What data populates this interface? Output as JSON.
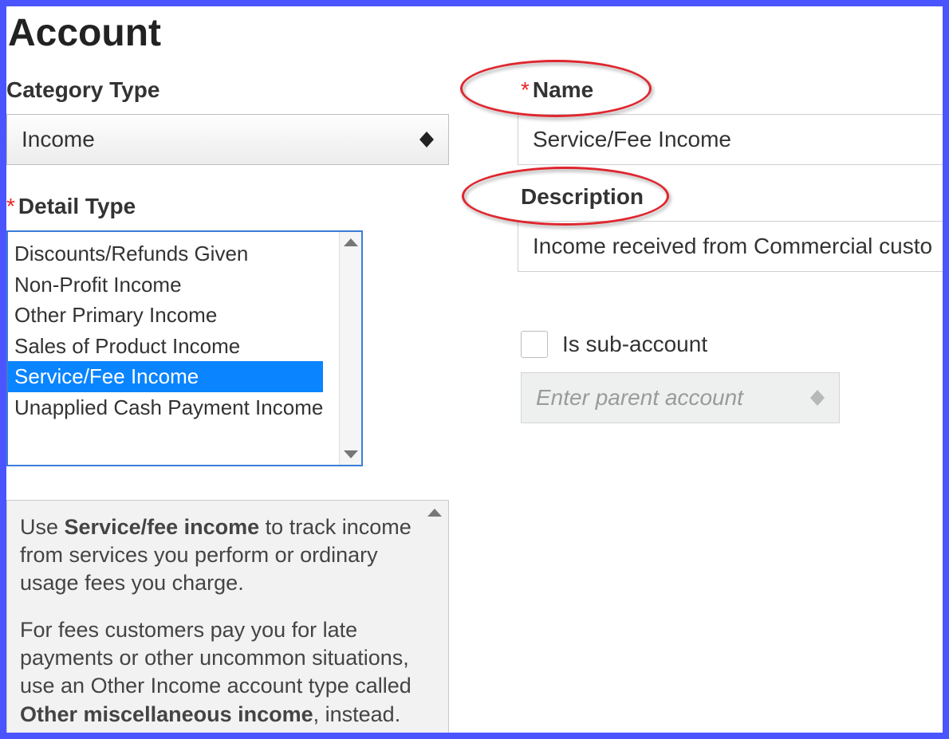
{
  "page_title": "Account",
  "category_type": {
    "label": "Category Type",
    "value": "Income"
  },
  "detail_type": {
    "label": "Detail Type",
    "options": [
      "Discounts/Refunds Given",
      "Non-Profit Income",
      "Other Primary Income",
      "Sales of Product Income",
      "Service/Fee Income",
      "Unapplied Cash Payment Income"
    ],
    "selected_index": 4
  },
  "name": {
    "label": "Name",
    "value": "Service/Fee Income"
  },
  "description": {
    "label": "Description",
    "value": "Income received from Commercial custo"
  },
  "sub_account": {
    "checkbox_label": "Is sub-account",
    "parent_placeholder": "Enter parent account"
  },
  "help": {
    "p1_pre": "Use ",
    "p1_bold": "Service/fee income",
    "p1_post": " to track income from services you perform or ordinary usage fees you charge.",
    "p2_pre": "For fees customers pay you for late payments or other uncommon situations, use an Other Income account type called ",
    "p2_bold": "Other miscellaneous income",
    "p2_post": ", instead."
  }
}
